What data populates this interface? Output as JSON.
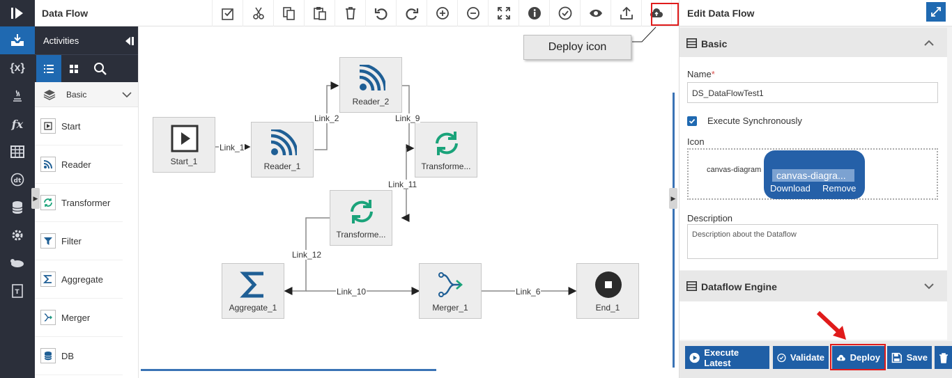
{
  "topbar": {
    "title": "Data Flow"
  },
  "activities": {
    "header": "Activities",
    "category": "Basic",
    "items": [
      {
        "label": "Start",
        "icon": "play-icon"
      },
      {
        "label": "Reader",
        "icon": "rss-icon"
      },
      {
        "label": "Transformer",
        "icon": "refresh-icon"
      },
      {
        "label": "Filter",
        "icon": "filter-icon"
      },
      {
        "label": "Aggregate",
        "icon": "sigma-icon"
      },
      {
        "label": "Merger",
        "icon": "merge-icon"
      },
      {
        "label": "DB",
        "icon": "database-icon"
      }
    ]
  },
  "canvas": {
    "callout": "Deploy icon",
    "nodes": {
      "start": "Start_1",
      "reader1": "Reader_1",
      "reader2": "Reader_2",
      "transformer_a": "Transforme...",
      "transformer_b": "Transforme...",
      "aggregate": "Aggregate_1",
      "merger": "Merger_1",
      "end": "End_1"
    },
    "links": {
      "l1": "Link_1",
      "l2": "Link_2",
      "l9": "Link_9",
      "l11": "Link_11",
      "l12": "Link_12",
      "l10": "Link_10",
      "l6": "Link_6"
    }
  },
  "panel": {
    "title": "Edit Data Flow",
    "basic_section": "Basic",
    "name_label": "Name",
    "required_mark": "*",
    "name_value": "DS_DataFlowTest1",
    "execute_sync_label": "Execute Synchronously",
    "execute_sync_checked": true,
    "icon_label": "Icon",
    "icon_filename": "canvas-diagram",
    "icon_pill_name": "canvas-diagra...",
    "download_label": "Download",
    "remove_label": "Remove",
    "description_label": "Description",
    "description_placeholder": "Description about the Dataflow",
    "engine_section": "Dataflow Engine"
  },
  "footer": {
    "execute_latest": "Execute Latest",
    "validate": "Validate",
    "deploy": "Deploy",
    "save": "Save"
  },
  "colors": {
    "accent": "#1f69b1",
    "rail": "#2b2f3a",
    "highlight": "#e01b1b",
    "rss": "#1f5f95",
    "transform": "#1aa37a"
  }
}
